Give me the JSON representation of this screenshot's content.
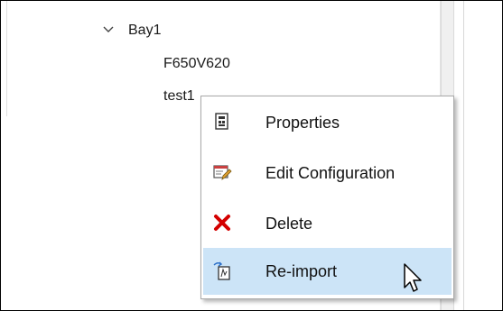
{
  "tree": {
    "nodes": [
      {
        "label": "Bay1",
        "expanded": true
      },
      {
        "label": "F650V620"
      },
      {
        "label": "test1"
      }
    ]
  },
  "context_menu": {
    "items": [
      {
        "label": "Properties",
        "icon": "properties-icon"
      },
      {
        "label": "Edit Configuration",
        "icon": "edit-configuration-icon"
      },
      {
        "label": "Delete",
        "icon": "delete-icon"
      },
      {
        "label": "Re-import",
        "icon": "reimport-icon",
        "highlighted": true
      }
    ],
    "hover_color": "#cce4f7"
  },
  "colors": {
    "delete_red": "#d40000",
    "accent_blue": "#2a6fc9"
  }
}
